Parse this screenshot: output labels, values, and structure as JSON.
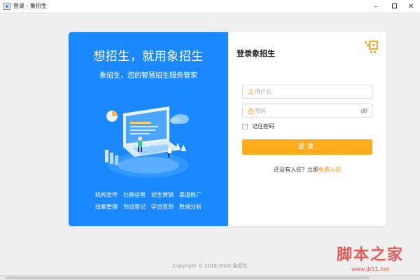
{
  "window": {
    "title": "登录 - 象招生",
    "minimize_glyph": "–",
    "close_glyph": "✕"
  },
  "promo": {
    "headline": "想招生，就用象招生",
    "subheadline": "象招生，您的智慧招生服务管家",
    "features": [
      [
        "机构宣传",
        "社群运营",
        "招生营销",
        "渠道推广"
      ],
      [
        "线索管理",
        "到访登记",
        "学员签到",
        "数据分析"
      ]
    ]
  },
  "login": {
    "title": "登录象招生",
    "username_placeholder": "用户名",
    "password_placeholder": "密码",
    "remember_label": "记住密码",
    "submit_label": "登录",
    "register_prompt": "还没有入驻？立即",
    "register_link": "免费入驻"
  },
  "footer": {
    "copyright": "Copyright © 2018-2020 象招生"
  },
  "watermark": {
    "main": "脚本之家",
    "sub": "www.jb51.net"
  },
  "colors": {
    "promo_bg": "#1c88ff",
    "primary_button": "#ffac1c",
    "link": "#ff8a00",
    "page_bg": "#efefef"
  },
  "icons": [
    "app-icon",
    "user-icon",
    "lock-icon",
    "eye-hidden-icon",
    "qr-code-icon",
    "illustration"
  ]
}
